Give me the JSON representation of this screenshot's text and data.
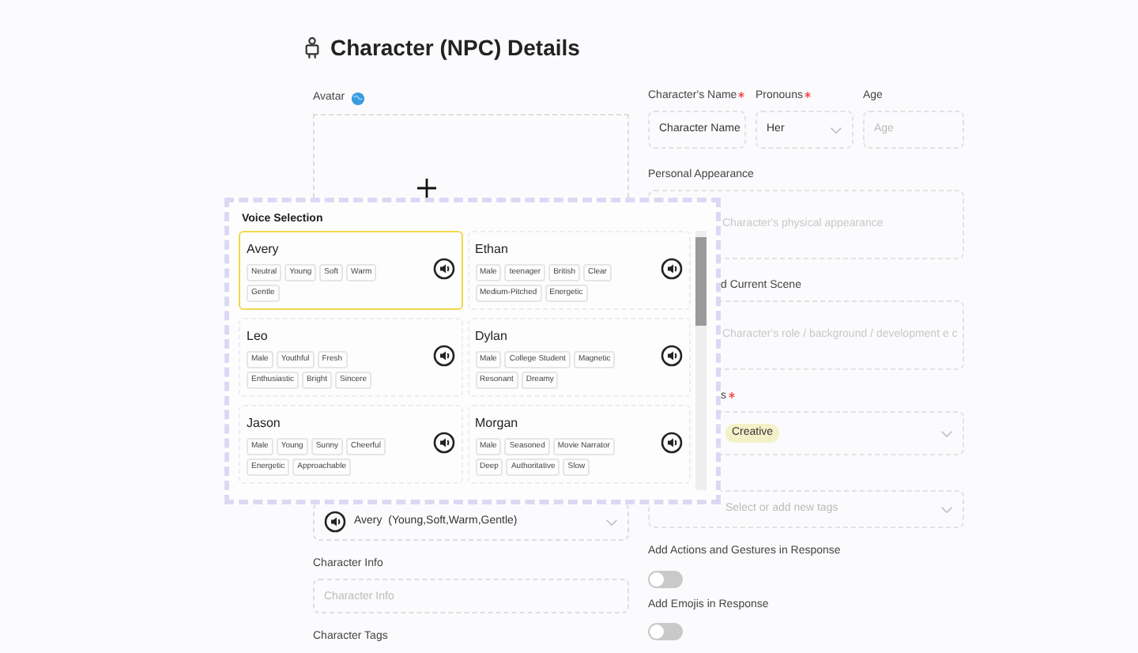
{
  "page": {
    "title": "Character (NPC) Details"
  },
  "avatar": {
    "label": "Avatar"
  },
  "voice_select": {
    "name": "Avery",
    "tags": "(Young,Soft,Warm,Gentle)"
  },
  "character_info": {
    "label": "Character Info",
    "placeholder": "Character Info"
  },
  "character_tags": {
    "label": "Character Tags"
  },
  "right_fields": {
    "name": {
      "label": "Character's Name",
      "required": true,
      "value": "Character Name"
    },
    "pronouns": {
      "label": "Pronouns",
      "required": true,
      "value": "Her"
    },
    "age": {
      "label": "Age",
      "required": false,
      "placeholder": "Age"
    },
    "appearance": {
      "label": "Personal Appearance",
      "placeholder": "Character's physical appearance"
    },
    "scene": {
      "label": "d Current Scene",
      "placeholder": "Character's role / background / development e c"
    },
    "traits": {
      "label": "s",
      "required": true,
      "chips": [
        "Creative"
      ]
    },
    "tags": {
      "placeholder": "Select or add new tags"
    }
  },
  "toggles": [
    {
      "label": "Add Actions and Gestures in Response",
      "on": false
    },
    {
      "label": "Add Emojis in Response",
      "on": false
    }
  ],
  "voice_popup": {
    "title": "Voice Selection",
    "voices": [
      {
        "name": "Avery",
        "selected": true,
        "tags": [
          "Neutral",
          "Young",
          "Soft",
          "Warm",
          "Gentle"
        ]
      },
      {
        "name": "Ethan",
        "selected": false,
        "tags": [
          "Male",
          "teenager",
          "British",
          "Clear",
          "Medium-Pitched",
          "Energetic"
        ]
      },
      {
        "name": "Leo",
        "selected": false,
        "tags": [
          "Male",
          "Youthful",
          "Fresh",
          "Enthusiastic",
          "Bright",
          "Sincere"
        ]
      },
      {
        "name": "Dylan",
        "selected": false,
        "tags": [
          "Male",
          "College Student",
          "Magnetic",
          "Resonant",
          "Dreamy"
        ]
      },
      {
        "name": "Jason",
        "selected": false,
        "tags": [
          "Male",
          "Young",
          "Sunny",
          "Cheerful",
          "Energetic",
          "Approachable"
        ]
      },
      {
        "name": "Morgan",
        "selected": false,
        "tags": [
          "Male",
          "Seasoned",
          "Movie Narrator",
          "Deep",
          "Authoritative",
          "Slow"
        ]
      }
    ]
  }
}
